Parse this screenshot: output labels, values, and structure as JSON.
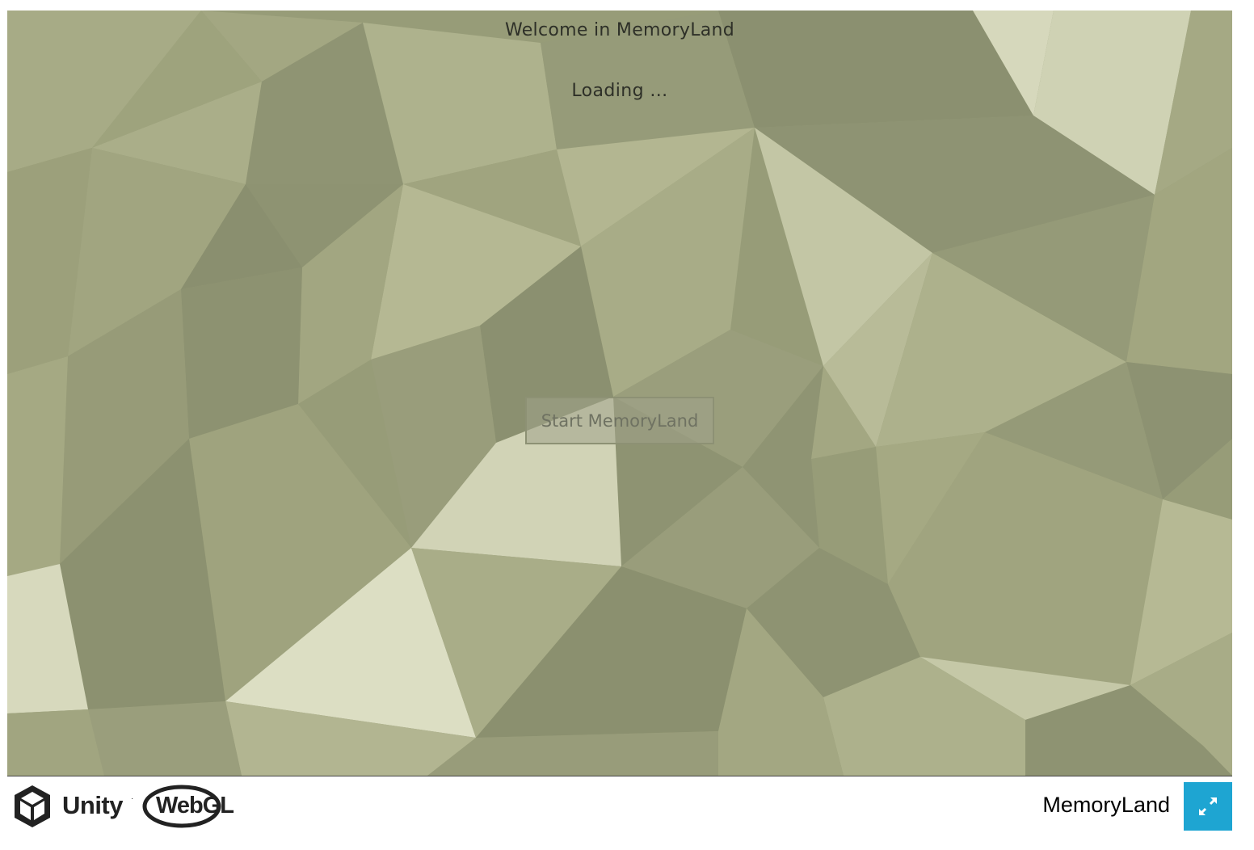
{
  "game": {
    "welcome_text": "Welcome in MemoryLand",
    "loading_text": "Loading ...",
    "start_button_label": "Start MemoryLand"
  },
  "footer": {
    "unity_label": "Unity",
    "unity_trademark": "·",
    "webgl_label": "WebGL",
    "build_title": "MemoryLand",
    "fullscreen_icon": "fullscreen-icon"
  },
  "colors": {
    "background_base": "#979c78",
    "fullscreen_button": "#1ea5d2",
    "text_dark": "#2e3028"
  }
}
